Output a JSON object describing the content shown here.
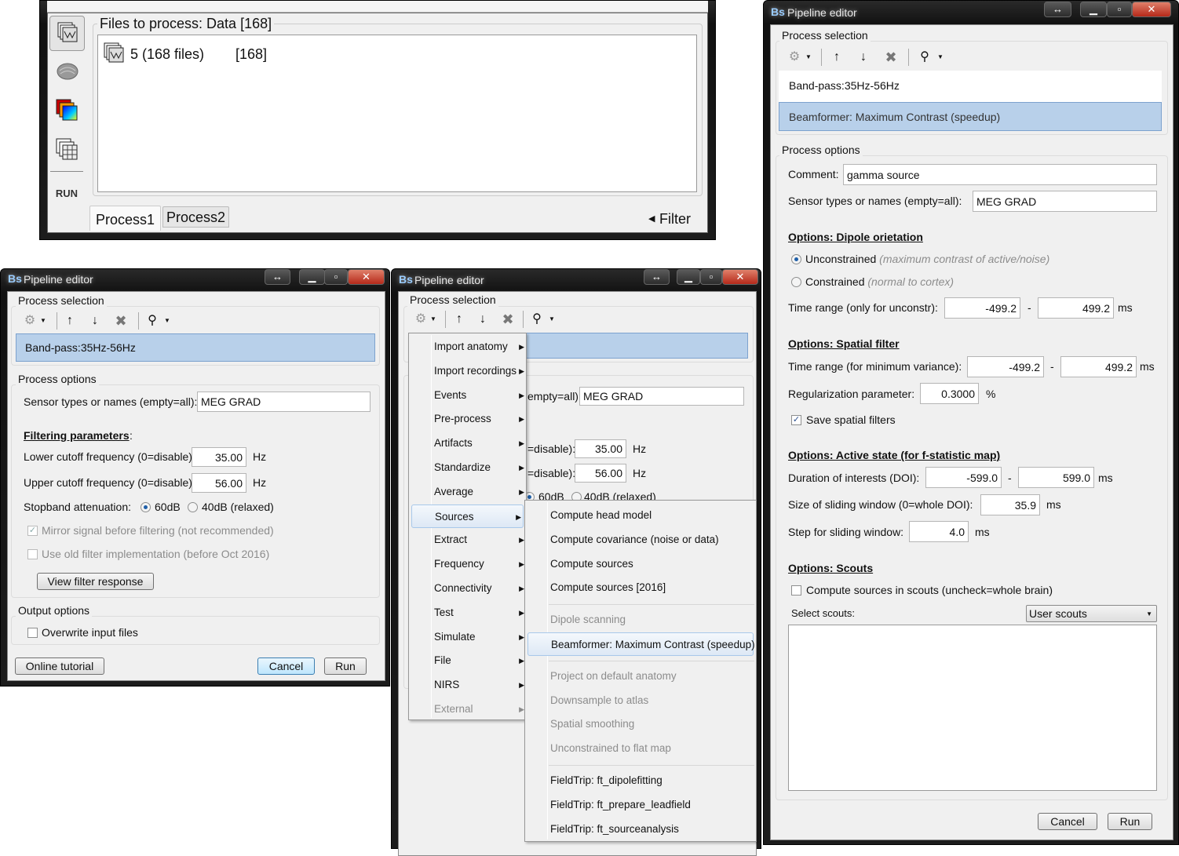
{
  "main_window": {
    "files_title": "Files to process: Data [168]",
    "item_label": "5 (168 files)",
    "item_count": "[168]",
    "run_label": "RUN",
    "tabs": [
      "Process1",
      "Process2"
    ],
    "filter_label": "Filter"
  },
  "left_editor": {
    "title": "Pipeline editor",
    "process_selection_label": "Process selection",
    "processes": [
      "Band-pass:35Hz-56Hz"
    ],
    "process_options_label": "Process options",
    "sensor_label": "Sensor types or names (empty=all):",
    "sensor_value": "MEG GRAD",
    "filtering_heading": "Filtering parameters",
    "lower_label": "Lower cutoff frequency (0=disable):",
    "lower_value": "35.00",
    "upper_label": "Upper cutoff frequency (0=disable):",
    "upper_value": "56.00",
    "unit_hz": "Hz",
    "stopband_label": "Stopband attenuation:",
    "opt_60": "60dB",
    "opt_40": "40dB (relaxed)",
    "stopband_selected": "60dB",
    "mirror_label": "Mirror signal before filtering (not recommended)",
    "mirror_checked": true,
    "oldfilter_label": "Use old filter implementation (before Oct 2016)",
    "oldfilter_checked": false,
    "view_filter_button": "View filter response",
    "output_options_label": "Output options",
    "overwrite_label": "Overwrite input files",
    "overwrite_checked": false,
    "online_tutorial": "Online tutorial",
    "cancel": "Cancel",
    "run": "Run"
  },
  "middle_editor": {
    "title": "Pipeline editor",
    "process_selection_label": "Process selection",
    "sensor_partial": "empty=all):",
    "sensor_value": "MEG GRAD",
    "lower_partial": "=disable):",
    "lower_value": "35.00",
    "upper_partial": "=disable):",
    "upper_value": "56.00",
    "unit_hz": "Hz",
    "opt_60": "60dB",
    "opt_40": "40dB (relaxed)"
  },
  "menu": {
    "items": [
      {
        "label": "Import anatomy",
        "disabled": false
      },
      {
        "label": "Import recordings",
        "disabled": false
      },
      {
        "label": "Events",
        "disabled": false
      },
      {
        "label": "Pre-process",
        "disabled": false
      },
      {
        "label": "Artifacts",
        "disabled": false
      },
      {
        "label": "Standardize",
        "disabled": false
      },
      {
        "label": "Average",
        "disabled": false
      },
      {
        "label": "Sources",
        "disabled": false,
        "highlighted": true
      },
      {
        "label": "Extract",
        "disabled": false
      },
      {
        "label": "Frequency",
        "disabled": false
      },
      {
        "label": "Connectivity",
        "disabled": false
      },
      {
        "label": "Test",
        "disabled": false
      },
      {
        "label": "Simulate",
        "disabled": false
      },
      {
        "label": "File",
        "disabled": false
      },
      {
        "label": "NIRS",
        "disabled": false
      },
      {
        "label": "External",
        "disabled": true
      }
    ],
    "submenu_groups": [
      [
        {
          "label": "Compute head model",
          "disabled": false
        },
        {
          "label": "Compute covariance (noise or data)",
          "disabled": false
        },
        {
          "label": "Compute sources",
          "disabled": false
        },
        {
          "label": "Compute sources [2016]",
          "disabled": false
        }
      ],
      [
        {
          "label": "Dipole scanning",
          "disabled": true
        },
        {
          "label": "Beamformer: Maximum Contrast (speedup)",
          "disabled": false,
          "highlighted": true
        }
      ],
      [
        {
          "label": "Project on default anatomy",
          "disabled": true
        },
        {
          "label": "Downsample to atlas",
          "disabled": true
        },
        {
          "label": "Spatial smoothing",
          "disabled": true
        },
        {
          "label": "Unconstrained to flat map",
          "disabled": true
        }
      ],
      [
        {
          "label": "FieldTrip: ft_dipolefitting",
          "disabled": false
        },
        {
          "label": "FieldTrip: ft_prepare_leadfield",
          "disabled": false
        },
        {
          "label": "FieldTrip: ft_sourceanalysis",
          "disabled": false
        }
      ]
    ]
  },
  "right_editor": {
    "title": "Pipeline editor",
    "process_selection_label": "Process selection",
    "processes": [
      "Band-pass:35Hz-56Hz",
      "Beamformer: Maximum Contrast (speedup)"
    ],
    "process_options_label": "Process options",
    "comment_label": "Comment:",
    "comment_value": "gamma source",
    "sensor_label": "Sensor types or names (empty=all):",
    "sensor_value": "MEG GRAD",
    "dipole_heading": "Options: Dipole orietation",
    "unconstrained": "Unconstrained",
    "unconstrained_hint": "(maximum contrast of active/noise)",
    "constrained": "Constrained",
    "constrained_hint": "(normal to cortex)",
    "orientation_selected": "Unconstrained",
    "time_unconstr_label": "Time range (only for unconstr):",
    "time_unconstr_start": "-499.2",
    "time_unconstr_end": "499.2",
    "dash": "-",
    "unit_ms": "ms",
    "spatial_heading": "Options: Spatial filter",
    "time_minvar_label": "Time range (for minimum variance):",
    "time_minvar_start": "-499.2",
    "time_minvar_end": "499.2",
    "reg_label": "Regularization parameter:",
    "reg_value": "0.3000",
    "unit_pct": "%",
    "save_filters_label": "Save spatial filters",
    "save_filters_checked": true,
    "active_heading": "Options: Active state (for f-statistic map)",
    "doi_label": "Duration of interests (DOI):",
    "doi_start": "-599.0",
    "doi_end": "599.0",
    "sliding_label": "Size of sliding window (0=whole DOI):",
    "sliding_value": "35.9",
    "step_label": "Step for sliding window:",
    "step_value": "4.0",
    "scouts_heading": "Options: Scouts",
    "scouts_label": "Compute sources in scouts (uncheck=whole brain)",
    "scouts_checked": false,
    "select_scouts_label": "Select scouts:",
    "select_scouts_value": "User scouts",
    "cancel": "Cancel",
    "run": "Run"
  },
  "colors": {
    "selection": "#b8d0ea",
    "window_bg": "#f0f0f0",
    "title_bar": "#1c1c1c"
  }
}
